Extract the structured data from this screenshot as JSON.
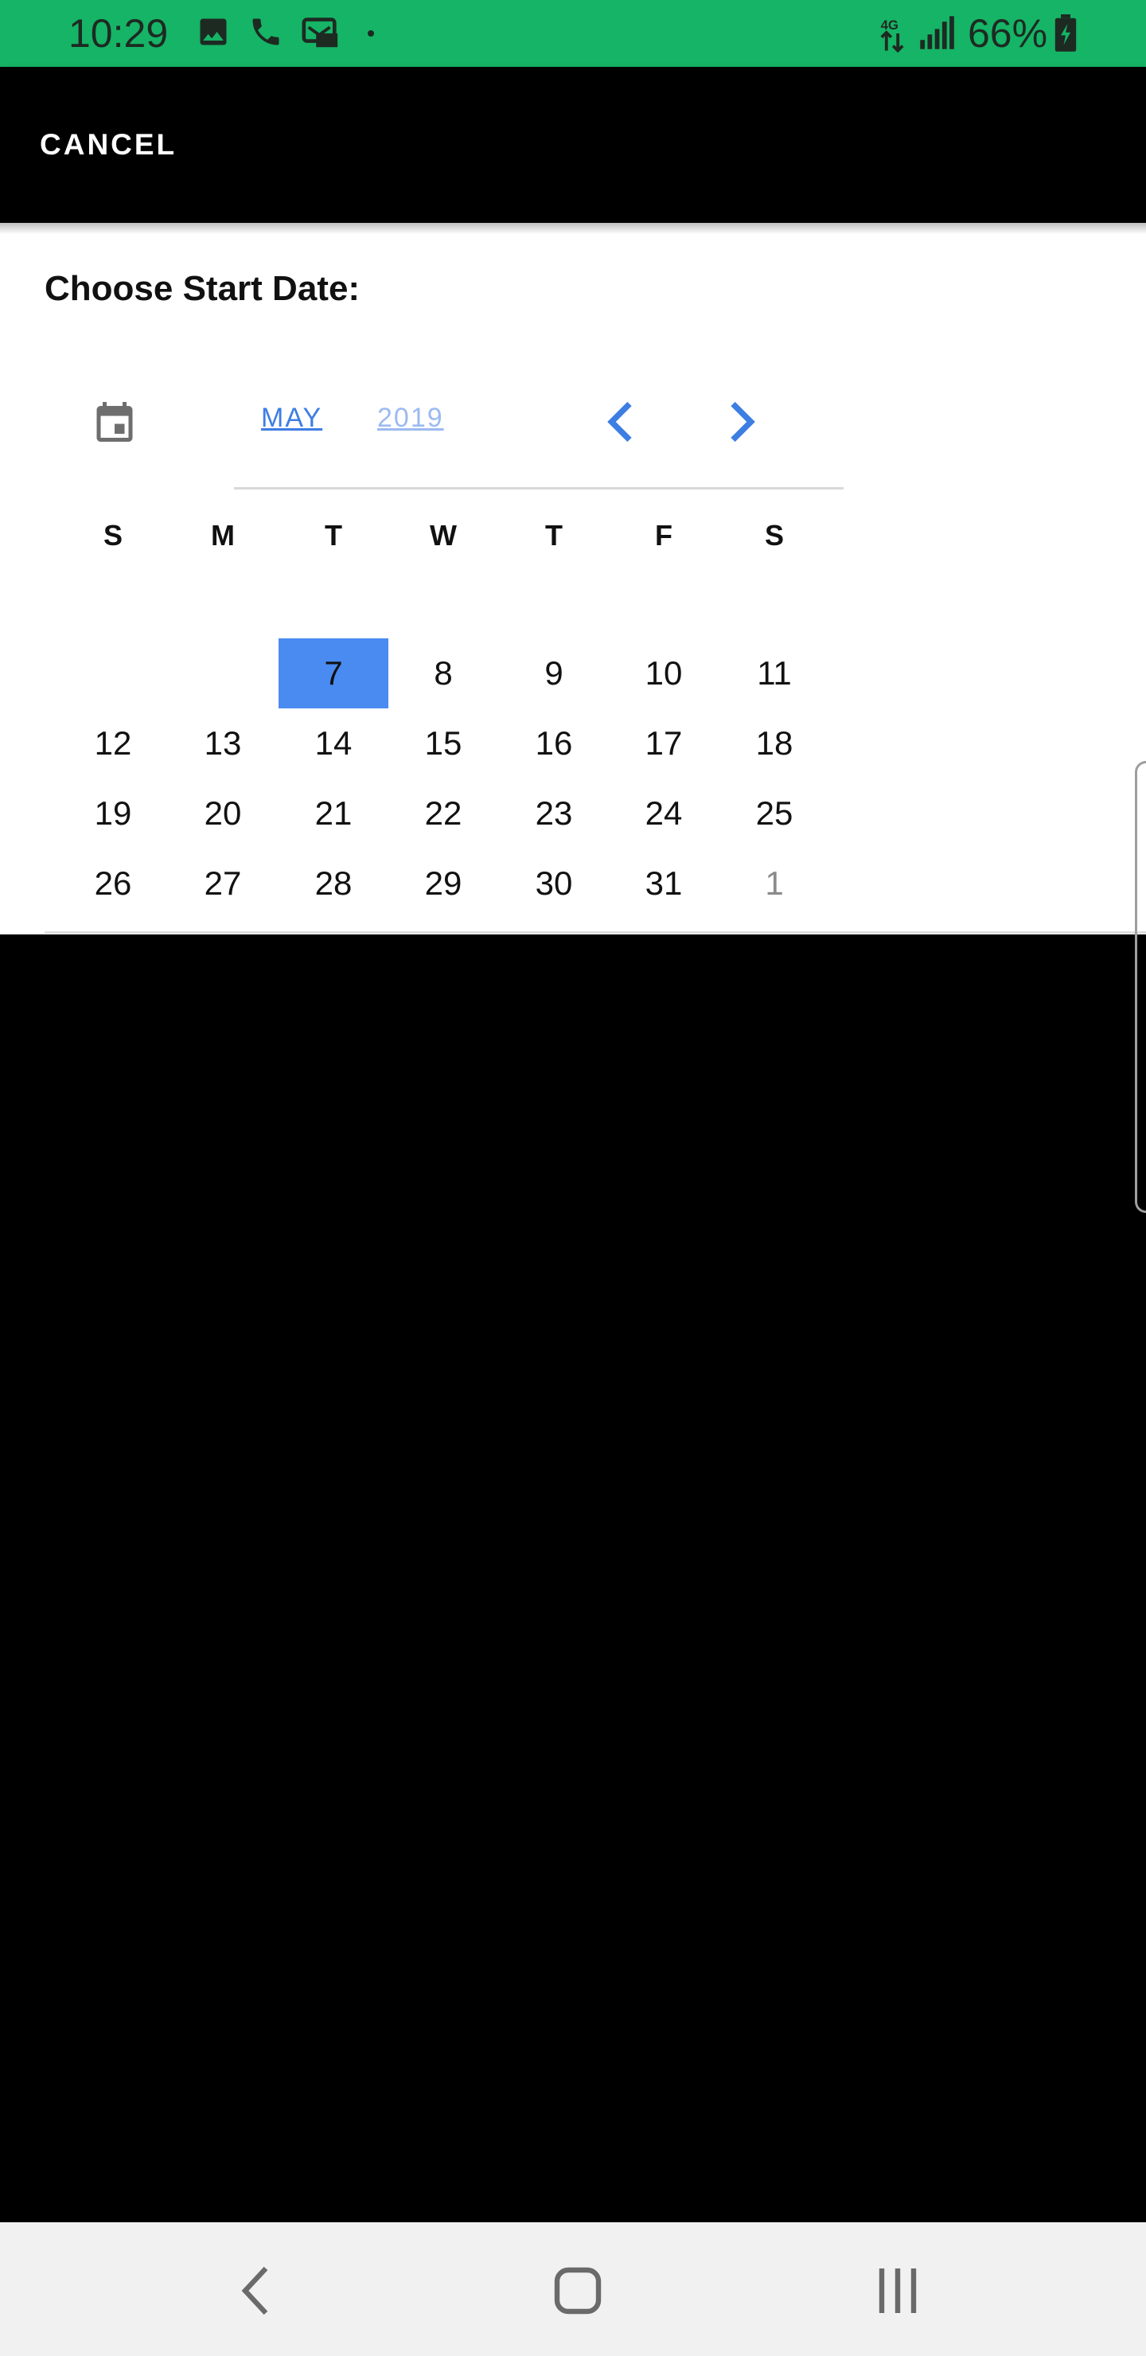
{
  "status_bar": {
    "time": "10:29",
    "battery_percent": "66%",
    "icons": [
      "image-icon",
      "phone-icon",
      "voicemail-icon",
      "data-4g-icon",
      "signal-icon",
      "battery-charging-icon"
    ]
  },
  "toolbar": {
    "cancel_label": "CANCEL"
  },
  "picker": {
    "title": "Choose Start Date:",
    "month": "MAY",
    "year": "2019",
    "weekdays": [
      "S",
      "M",
      "T",
      "W",
      "T",
      "F",
      "S"
    ],
    "weeks": [
      [
        "",
        "",
        "7",
        "8",
        "9",
        "10",
        "11"
      ],
      [
        "12",
        "13",
        "14",
        "15",
        "16",
        "17",
        "18"
      ],
      [
        "19",
        "20",
        "21",
        "22",
        "23",
        "24",
        "25"
      ],
      [
        "26",
        "27",
        "28",
        "29",
        "30",
        "31",
        "1"
      ]
    ],
    "selected_day": "7",
    "other_month_days": [
      "1"
    ]
  },
  "colors": {
    "status_bar": "#16b466",
    "accent": "#4a8bf2",
    "link": "#3d7ee3"
  }
}
